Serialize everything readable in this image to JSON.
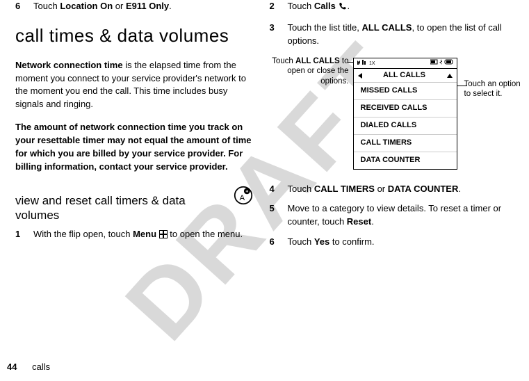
{
  "watermark": "DRAFT",
  "left": {
    "step6": {
      "num": "6",
      "pre": "Touch ",
      "opt1": "Location On",
      "mid": " or ",
      "opt2": "E911 Only",
      "post": "."
    },
    "h1": "call times & data volumes",
    "p1_lead": "Network connection time",
    "p1_rest": " is the elapsed time from the moment you connect to your service provider's network to the moment you end the call. This time includes busy signals and ringing.",
    "p2": "The amount of network connection time you track on your resettable timer may not equal the amount of time for which you are billed by your service provider. For billing information, contact your service provider.",
    "h2": "view and reset call timers & data volumes",
    "step1": {
      "num": "1",
      "pre": "With the flip open, touch ",
      "menu": "Menu",
      "post": " to open the menu."
    }
  },
  "right": {
    "step2": {
      "num": "2",
      "pre": "Touch ",
      "calls": "Calls",
      "post": "."
    },
    "step3": {
      "num": "3",
      "pre": "Touch the list title, ",
      "all": "ALL CALLS",
      "post": ", to open the list of call options."
    },
    "callout_left_l1": "Touch ",
    "callout_left_bold": "ALL CALLS",
    "callout_left_l2": " to open or close the options.",
    "callout_right": "Touch an option to select it.",
    "menu": {
      "title": "ALL CALLS",
      "items": [
        "MISSED CALLS",
        "RECEIVED CALLS",
        "DIALED CALLS",
        "CALL TIMERS",
        "DATA COUNTER"
      ]
    },
    "step4": {
      "num": "4",
      "pre": "Touch ",
      "o1": "CALL TIMERS",
      "mid": " or ",
      "o2": "DATA COUNTER",
      "post": "."
    },
    "step5": {
      "num": "5",
      "pre": "Move to a category to view details. To reset a timer or counter, touch ",
      "reset": "Reset",
      "post": "."
    },
    "step6b": {
      "num": "6",
      "pre": "Touch ",
      "yes": "Yes",
      "post": " to confirm."
    }
  },
  "footer": {
    "page": "44",
    "section": "calls"
  }
}
